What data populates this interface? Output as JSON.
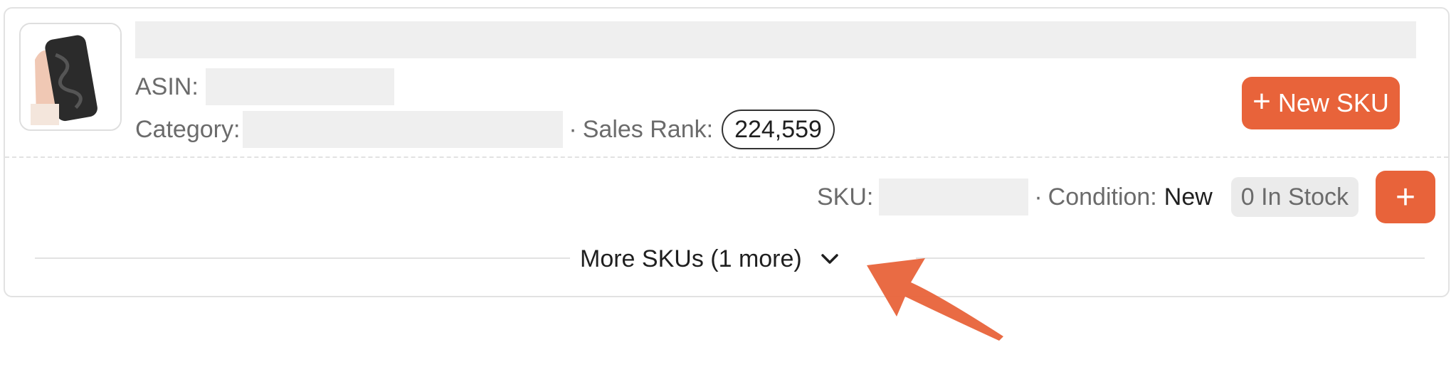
{
  "product": {
    "thumbnail_icon": "phone-case-thumbnail",
    "asin_label": "ASIN:",
    "category_label": "Category:",
    "sales_rank_label": "Sales Rank:",
    "sales_rank_value": "224,559",
    "separator": "·"
  },
  "actions": {
    "new_sku_label": "New SKU",
    "new_sku_icon": "plus-icon"
  },
  "sku": {
    "sku_label": "SKU:",
    "condition_label": "Condition:",
    "condition_value": "New",
    "stock_badge": "0 In Stock",
    "add_icon": "plus-icon"
  },
  "more_skus": {
    "label": "More SKUs (1 more)",
    "icon": "chevron-down-icon"
  },
  "colors": {
    "accent": "#e8633a",
    "redaction": "#efefef"
  }
}
